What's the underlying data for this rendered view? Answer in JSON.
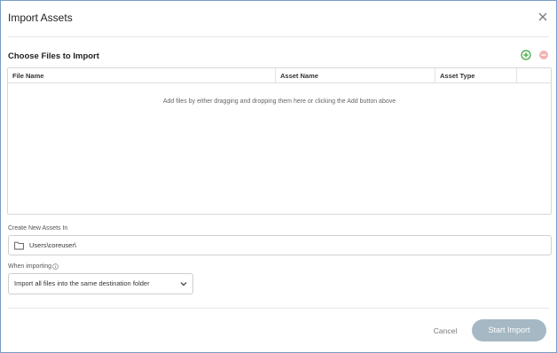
{
  "dialog": {
    "title": "Import Assets",
    "close_icon": "close-icon"
  },
  "files_section": {
    "title": "Choose Files to Import",
    "add_icon": "add-circle-icon",
    "remove_icon": "remove-circle-icon",
    "columns": [
      "File Name",
      "Asset Name",
      "Asset Type",
      ""
    ],
    "rows": [],
    "empty_message": "Add files by either dragging and dropping them here or clicking the Add button above"
  },
  "destination": {
    "label": "Create New Assets In",
    "path": "Users\\coreuser\\",
    "icon": "folder-icon"
  },
  "when_importing": {
    "label": "When importing",
    "info_icon": "info-icon",
    "selected_option": "Import all files into the same destination folder"
  },
  "footer": {
    "cancel_label": "Cancel",
    "start_label": "Start Import"
  },
  "colors": {
    "add_green": "#3aa53a",
    "remove_red": "#e6a0a0",
    "primary_disabled": "#a5b8c3",
    "border_blue": "#7a9cc6"
  }
}
